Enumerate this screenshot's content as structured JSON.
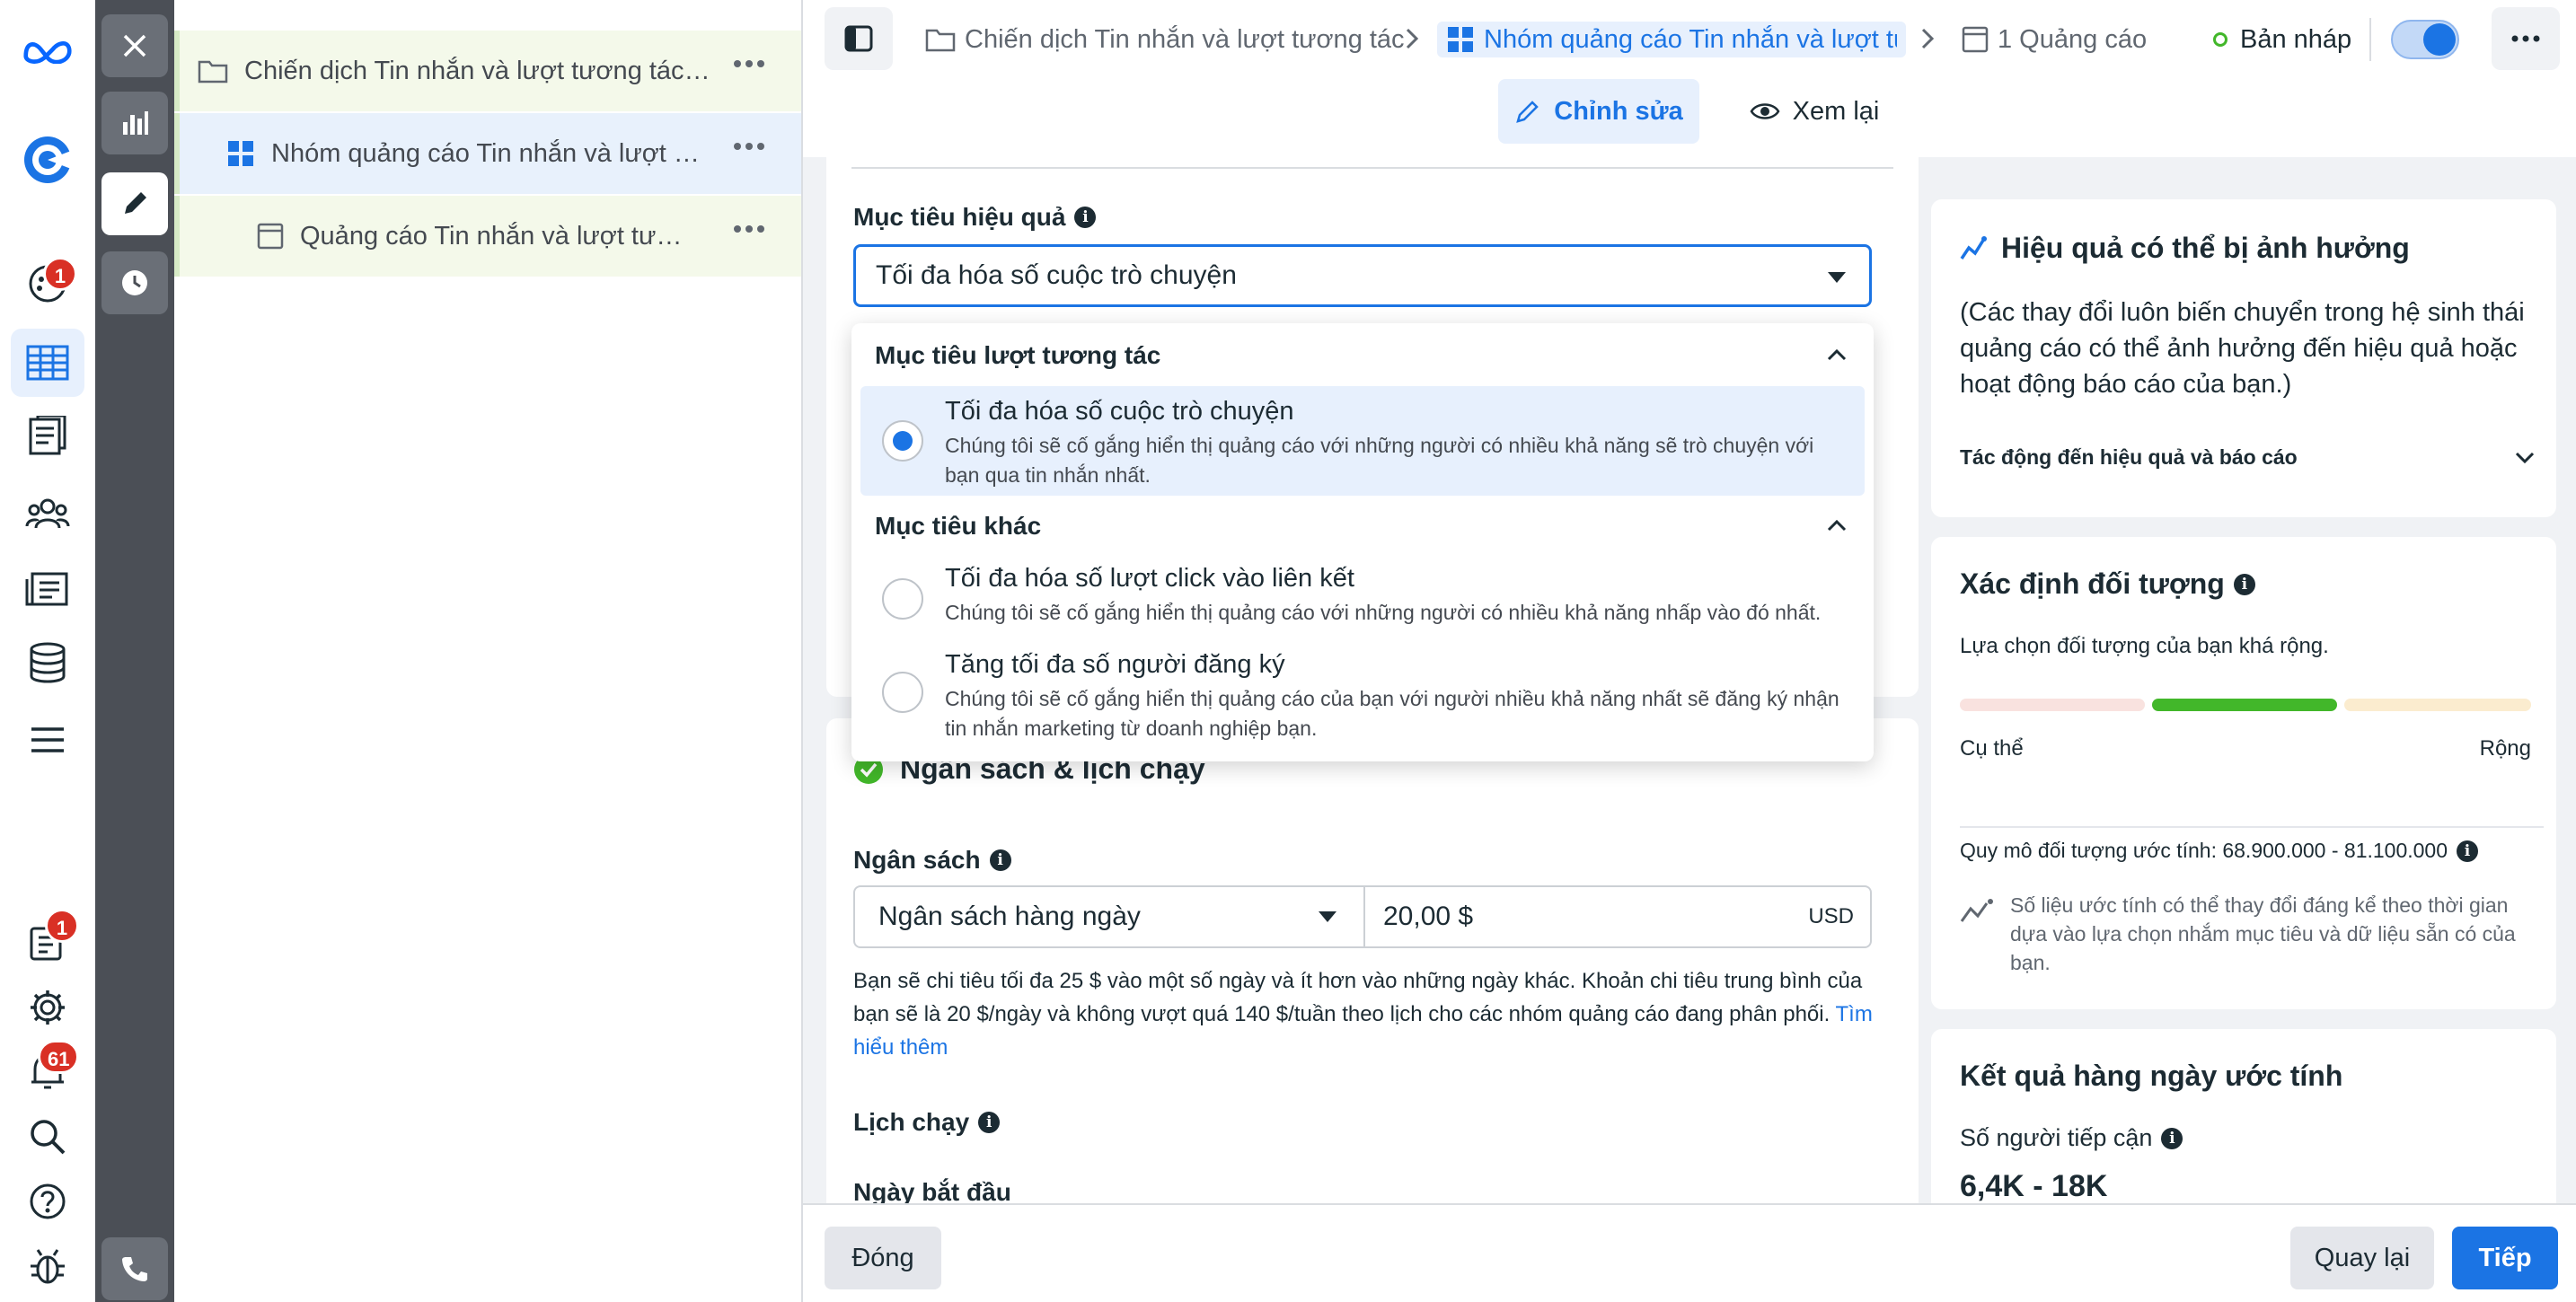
{
  "nav": {
    "badges": {
      "activity": "1",
      "notices": "1",
      "notifications": "61"
    }
  },
  "tree": {
    "campaign": "Chiến dịch Tin nhắn và lượt tương tác ...",
    "adset": "Nhóm quảng cáo Tin nhắn và lượt tư...",
    "ad": "Quảng cáo Tin nhắn và lượt tươn..."
  },
  "breadcrumb": {
    "campaign": "Chiến dịch Tin nhắn và lượt tương tác",
    "adset": "Nhóm quảng cáo Tin nhắn và lượt tươ",
    "ad": "1 Quảng cáo"
  },
  "status": {
    "draft": "Bản nháp"
  },
  "modes": {
    "edit": "Chỉnh sửa",
    "review": "Xem lại"
  },
  "goal": {
    "label": "Mục tiêu hiệu quả",
    "selected": "Tối đa hóa số cuộc trò chuyện"
  },
  "dropdown": {
    "group1": "Mục tiêu lượt tương tác",
    "group2": "Mục tiêu khác",
    "options": [
      {
        "title": "Tối đa hóa số cuộc trò chuyện",
        "desc": "Chúng tôi sẽ cố gắng hiển thị quảng cáo với những người có nhiều khả năng sẽ trò chuyện với bạn qua tin nhắn nhất."
      },
      {
        "title": "Tối đa hóa số lượt click vào liên kết",
        "desc": "Chúng tôi sẽ cố gắng hiển thị quảng cáo với những người có nhiều khả năng nhấp vào đó nhất."
      },
      {
        "title": "Tăng tối đa số người đăng ký",
        "desc": "Chúng tôi sẽ cố gắng hiển thị quảng cáo của bạn với người nhiều khả năng nhất sẽ đăng ký nhận tin nhắn marketing từ doanh nghiệp bạn."
      }
    ]
  },
  "budget": {
    "section_title": "Ngân sách & lịch chạy",
    "label": "Ngân sách",
    "type": "Ngân sách hàng ngày",
    "amount": "20,00 $",
    "currency": "USD",
    "note": "Bạn sẽ chi tiêu tối đa 25 $ vào một số ngày và ít hơn vào những ngày khác. Khoản chi tiêu trung bình của bạn sẽ là 20 $/ngày và không vượt quá 140 $/tuần theo lịch cho các nhóm quảng cáo đang phân phối.",
    "learn_more": "Tìm hiểu thêm",
    "schedule_label": "Lịch chạy",
    "start_label": "Ngày bắt đầu"
  },
  "perf_card": {
    "title": "Hiệu quả có thể bị ảnh hưởng",
    "body": "(Các thay đổi luôn biến chuyển trong hệ sinh thái quảng cáo có thể ảnh hưởng đến hiệu quả hoặc hoạt động báo cáo của bạn.)",
    "link": "Tác động đến hiệu quả và báo cáo"
  },
  "audience_card": {
    "title": "Xác định đối tượng",
    "subtitle": "Lựa chọn đối tượng của bạn khá rộng.",
    "left": "Cụ thể",
    "right": "Rộng",
    "size": "Quy mô đối tượng ước tính: 68.900.000 - 81.100.000",
    "note": "Số liệu ước tính có thể thay đổi đáng kể theo thời gian dựa vào lựa chọn nhắm mục tiêu và dữ liệu sẵn có của bạn."
  },
  "results_card": {
    "title": "Kết quả hàng ngày ước tính",
    "reach_label": "Số người tiếp cận",
    "reach_value": "6,4K - 18K"
  },
  "footer": {
    "close": "Đóng",
    "back": "Quay lại",
    "next": "Tiếp"
  },
  "colors": {
    "accent": "#1b74e4",
    "green": "#42b72a",
    "badge": "#d93025"
  }
}
